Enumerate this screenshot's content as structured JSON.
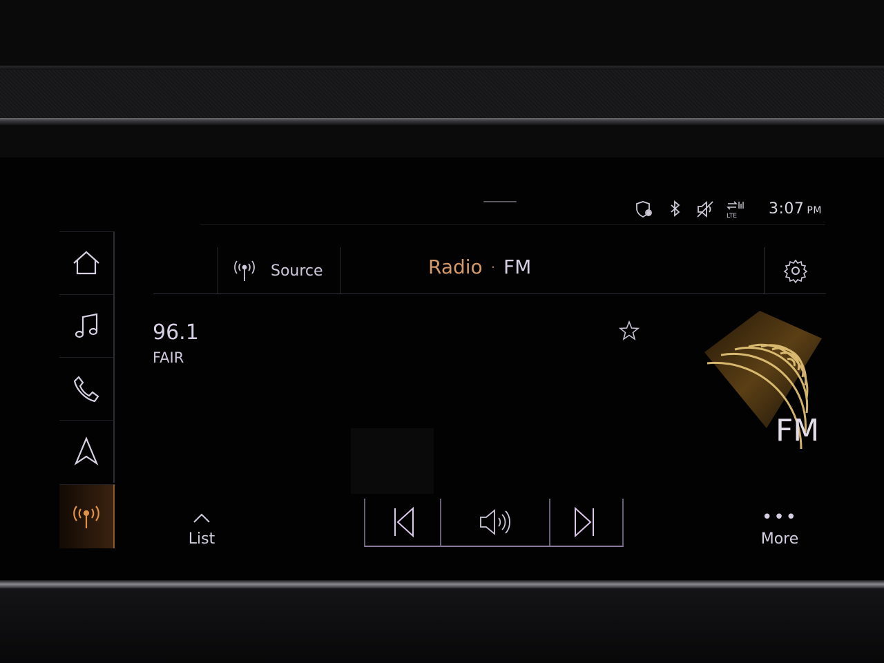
{
  "status_bar": {
    "time": "3:07",
    "ampm": "PM",
    "icons": [
      "location-shield-icon",
      "bluetooth-icon",
      "speaker-muted-icon",
      "lte-icon"
    ],
    "lte_label": "LTE"
  },
  "nav": {
    "items": [
      {
        "name": "home",
        "icon": "home-icon"
      },
      {
        "name": "music",
        "icon": "music-note-icon"
      },
      {
        "name": "phone",
        "icon": "phone-icon"
      },
      {
        "name": "navigation",
        "icon": "navigation-arrow-icon"
      },
      {
        "name": "radio",
        "icon": "radio-antenna-icon",
        "active": true
      }
    ]
  },
  "header": {
    "source_label": "Source",
    "title_main": "Radio",
    "title_separator": "·",
    "title_band": "FM"
  },
  "station": {
    "frequency": "96.1",
    "name": "FAIR"
  },
  "artwork": {
    "band_label": "FM"
  },
  "controls": {
    "list_label": "List",
    "more_label": "More",
    "more_dots": "•••"
  },
  "colors": {
    "accent_orange": "#d49a6a",
    "text_lavender": "#d6cfe3",
    "background": "#020203"
  }
}
